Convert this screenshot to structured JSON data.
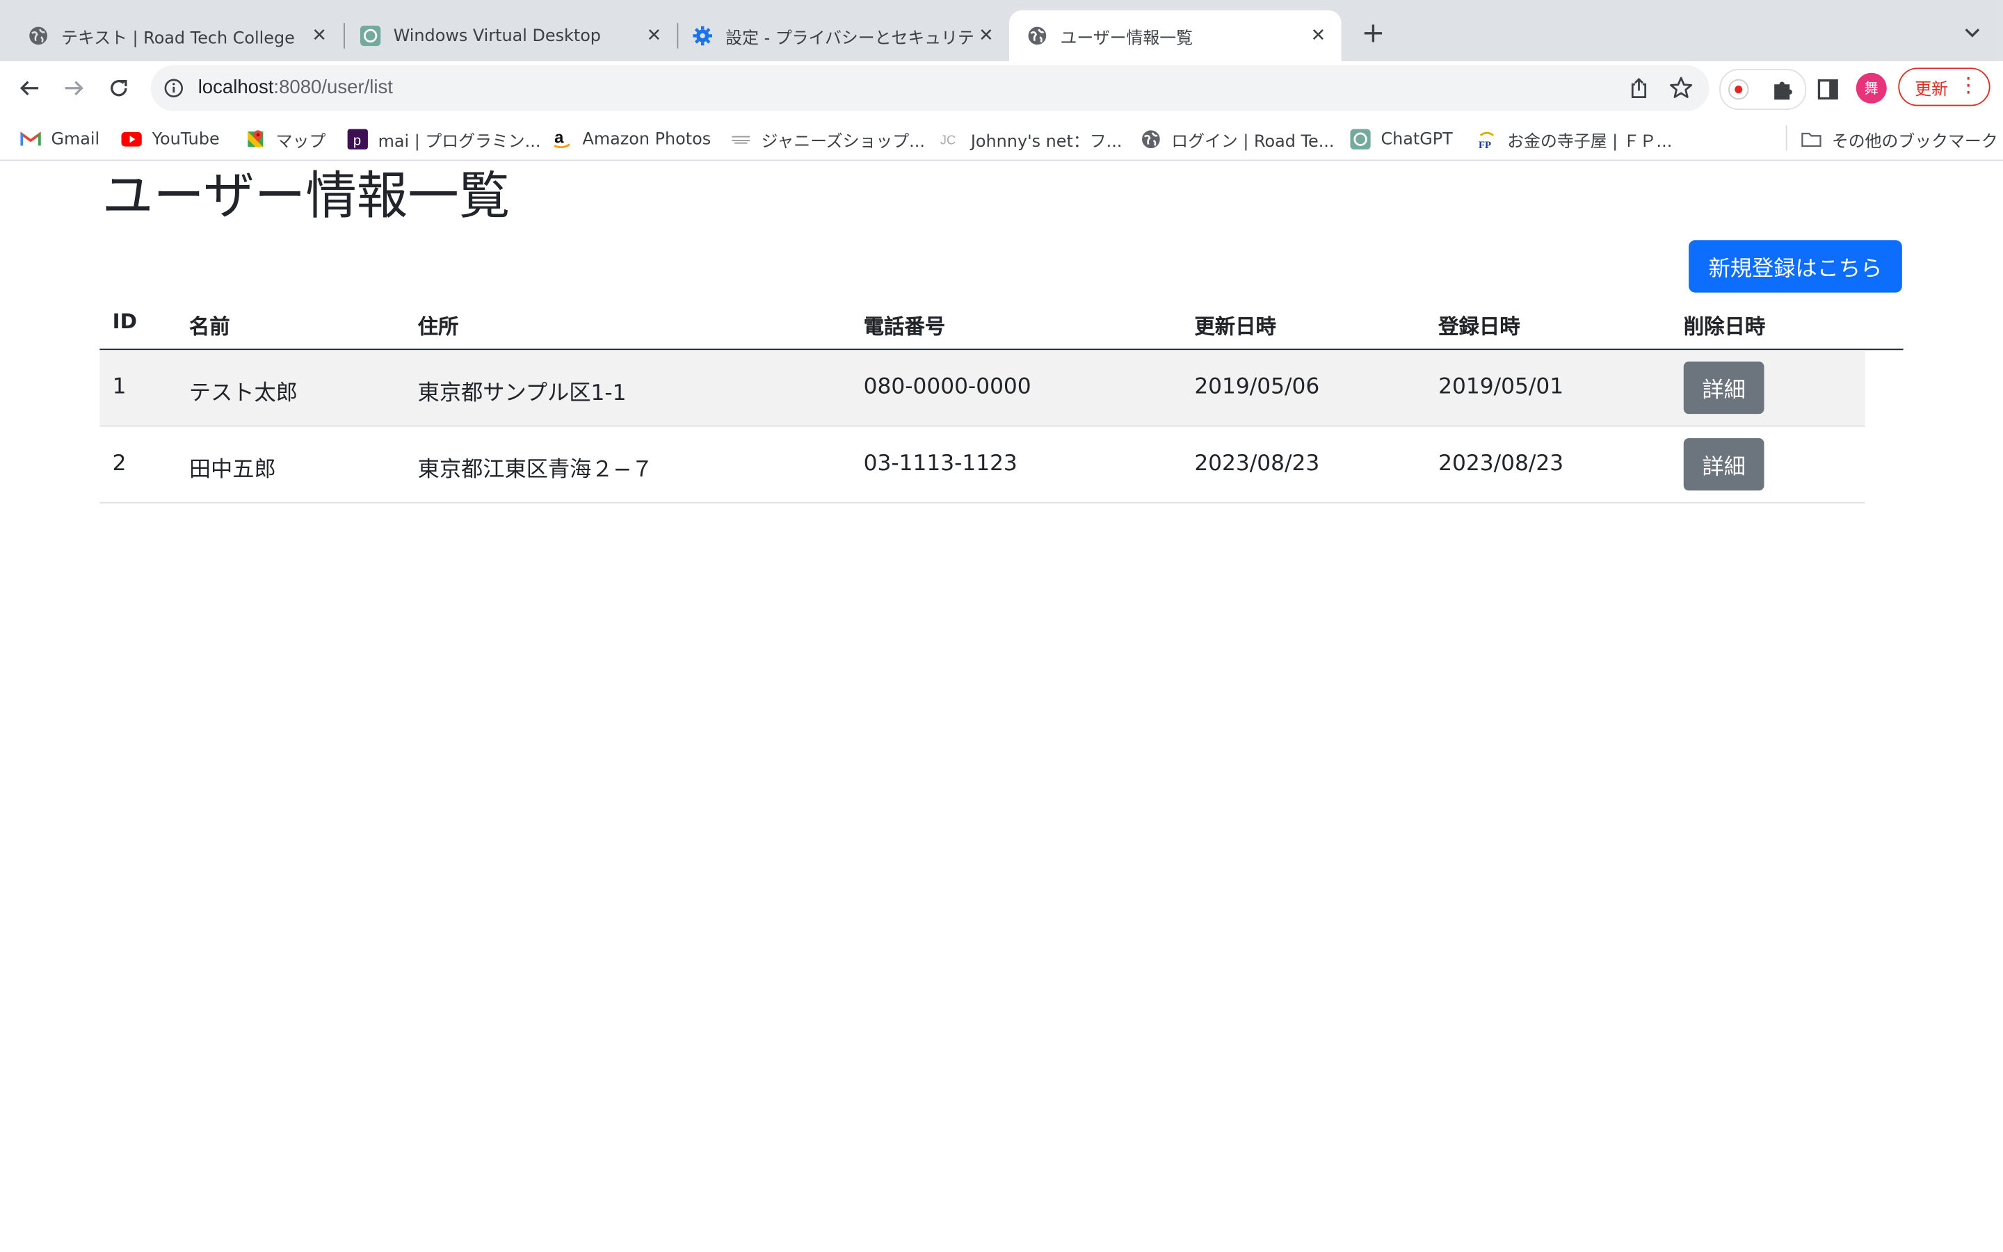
{
  "browser": {
    "tabs": [
      {
        "title": "テキスト | Road Tech College",
        "icon": "globe-icon"
      },
      {
        "title": "Windows Virtual Desktop",
        "icon": "chatgpt-icon"
      },
      {
        "title": "設定 - プライバシーとセキュリティ",
        "icon": "gear-icon"
      },
      {
        "title": "ユーザー情報一覧",
        "icon": "globe-icon",
        "active": true
      }
    ],
    "address": {
      "host": "localhost",
      "path": ":8080/user/list"
    },
    "avatar_letter": "舞",
    "update_label": "更新",
    "bookmarks": [
      {
        "label": "Gmail",
        "icon": "gmail-icon"
      },
      {
        "label": "YouTube",
        "icon": "youtube-icon"
      },
      {
        "label": "マップ",
        "icon": "maps-icon"
      },
      {
        "label": "mai | プログラミン...",
        "icon": "p-icon"
      },
      {
        "label": "Amazon Photos",
        "icon": "amazon-icon"
      },
      {
        "label": "ジャニーズショップ...",
        "icon": "shop-icon"
      },
      {
        "label": "Johnny's net：フ...",
        "icon": "jc-icon"
      },
      {
        "label": "ログイン | Road Te...",
        "icon": "globe-icon"
      },
      {
        "label": "ChatGPT",
        "icon": "chatgpt-icon"
      },
      {
        "label": "お金の寺子屋 | ＦＰ...",
        "icon": "fp-icon"
      }
    ],
    "other_bookmarks": "その他のブックマーク"
  },
  "page": {
    "title": "ユーザー情報一覧",
    "new_button": "新規登録はこちら",
    "columns": [
      "ID",
      "名前",
      "住所",
      "電話番号",
      "更新日時",
      "登録日時",
      "削除日時"
    ],
    "rows": [
      {
        "id": "1",
        "name": "テスト太郎",
        "address": "東京都サンプル区1-1",
        "phone": "080-0000-0000",
        "updated": "2019/05/06",
        "registered": "2019/05/01",
        "action": "詳細"
      },
      {
        "id": "2",
        "name": "田中五郎",
        "address": "東京都江東区青海２−７",
        "phone": "03-1113-1123",
        "updated": "2023/08/23",
        "registered": "2023/08/23",
        "action": "詳細"
      }
    ]
  },
  "colors": {
    "primary": "#0d6efd",
    "secondary": "#6c757d",
    "stripe": "#f2f2f2"
  }
}
